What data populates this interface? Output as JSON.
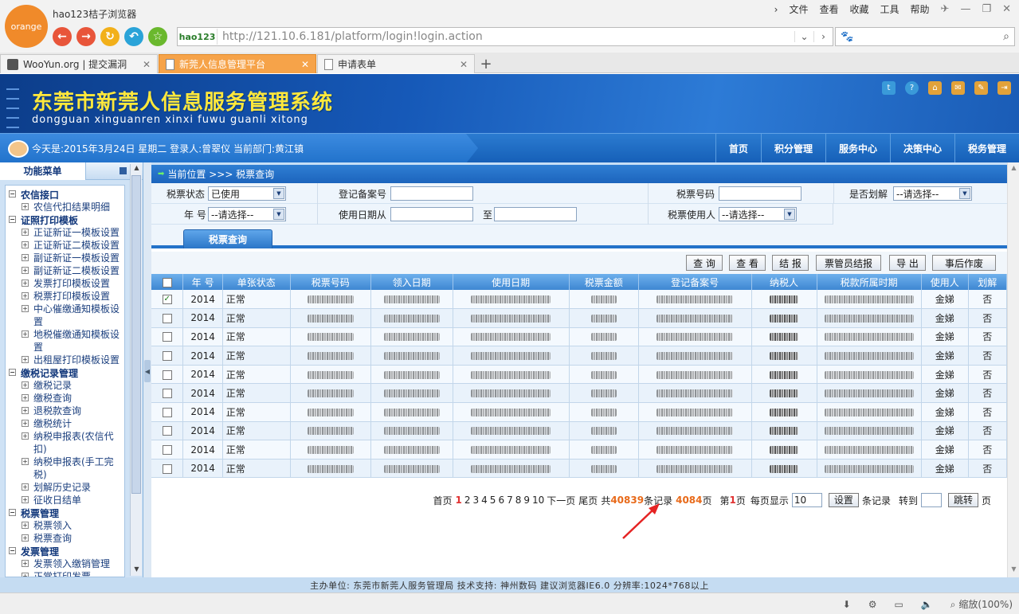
{
  "browser": {
    "logo_text": "orange",
    "title": "hao123桔子浏览器",
    "menu": [
      "文件",
      "查看",
      "收藏",
      "工具",
      "帮助"
    ],
    "url": "http://121.10.6.181/platform/login!login.action",
    "hao_badge": "hao123",
    "tabs": [
      {
        "label": "WooYun.org | 提交漏洞"
      },
      {
        "label": "新莞人信息管理平台"
      },
      {
        "label": "申请表单"
      }
    ],
    "status_zoom": "缩放(100%)"
  },
  "site": {
    "title": "东莞市新莞人信息服务管理系统",
    "subtitle": "dongguan xinguanren xinxi fuwu guanli xitong",
    "info": "今天是:2015年3月24日 星期二 登录人:曾翠仪 当前部门:黄江镇",
    "topnav": [
      "首页",
      "积分管理",
      "服务中心",
      "决策中心",
      "税务管理"
    ],
    "footer": "主办单位: 东莞市新莞人服务管理局    技术支持: 神州数码    建议浏览器IE6.0 分辨率:1024*768以上"
  },
  "sidebar": {
    "title": "功能菜单",
    "tree": [
      {
        "type": "group",
        "label": "农信接口"
      },
      {
        "type": "item",
        "label": "农信代扣结果明细"
      },
      {
        "type": "group",
        "label": "证照打印模板"
      },
      {
        "type": "item",
        "label": "正证新证一模板设置"
      },
      {
        "type": "item",
        "label": "正证新证二模板设置"
      },
      {
        "type": "item",
        "label": "副证新证一模板设置"
      },
      {
        "type": "item",
        "label": "副证新证二模板设置"
      },
      {
        "type": "item",
        "label": "发票打印模板设置"
      },
      {
        "type": "item",
        "label": "税票打印模板设置"
      },
      {
        "type": "item",
        "label": "中心催缴通知模板设置"
      },
      {
        "type": "item",
        "label": "地税催缴通知模板设置"
      },
      {
        "type": "item",
        "label": "出租屋打印模板设置"
      },
      {
        "type": "group",
        "label": "缴税记录管理"
      },
      {
        "type": "item",
        "label": "缴税记录"
      },
      {
        "type": "item",
        "label": "缴税查询"
      },
      {
        "type": "item",
        "label": "退税款查询"
      },
      {
        "type": "item",
        "label": "缴税统计"
      },
      {
        "type": "item",
        "label": "纳税申报表(农信代扣)"
      },
      {
        "type": "item",
        "label": "纳税申报表(手工完税)"
      },
      {
        "type": "item",
        "label": "划解历史记录"
      },
      {
        "type": "item",
        "label": "征收日结单"
      },
      {
        "type": "group",
        "label": "税票管理"
      },
      {
        "type": "item",
        "label": "税票领入"
      },
      {
        "type": "item",
        "label": "税票查询"
      },
      {
        "type": "group",
        "label": "发票管理"
      },
      {
        "type": "item",
        "label": "发票领入缴销管理"
      },
      {
        "type": "item",
        "label": "正常打印发票"
      }
    ]
  },
  "main": {
    "breadcrumb": "当前位置 >>> 税票查询",
    "filters": {
      "ticket_status_label": "税票状态",
      "ticket_status_value": "已使用",
      "reg_no_label": "登记备案号",
      "ticket_no_label": "税票号码",
      "split_label": "是否划解",
      "split_value": "--请选择--",
      "year_label": "年 号",
      "year_value": "--请选择--",
      "use_date_label": "使用日期从",
      "to_label": "至",
      "ticket_user_label": "税票使用人",
      "ticket_user_value": "--请选择--"
    },
    "query_tab": "税票查询",
    "toolbar": [
      "查 询",
      "查 看",
      "结 报",
      "票管员结报",
      "导 出",
      "事后作废"
    ],
    "columns": [
      "年 号",
      "单张状态",
      "税票号码",
      "领入日期",
      "使用日期",
      "税票金额",
      "登记备案号",
      "纳税人",
      "税款所属时期",
      "使用人",
      "划解"
    ],
    "rows": [
      {
        "checked": true,
        "year": "2014",
        "status": "正常",
        "user": "金娣",
        "split": "否"
      },
      {
        "checked": false,
        "year": "2014",
        "status": "正常",
        "user": "金娣",
        "split": "否"
      },
      {
        "checked": false,
        "year": "2014",
        "status": "正常",
        "user": "金娣",
        "split": "否"
      },
      {
        "checked": false,
        "year": "2014",
        "status": "正常",
        "user": "金娣",
        "split": "否"
      },
      {
        "checked": false,
        "year": "2014",
        "status": "正常",
        "user": "金娣",
        "split": "否"
      },
      {
        "checked": false,
        "year": "2014",
        "status": "正常",
        "user": "金娣",
        "split": "否"
      },
      {
        "checked": false,
        "year": "2014",
        "status": "正常",
        "user": "金娣",
        "split": "否"
      },
      {
        "checked": false,
        "year": "2014",
        "status": "正常",
        "user": "金娣",
        "split": "否"
      },
      {
        "checked": false,
        "year": "2014",
        "status": "正常",
        "user": "金娣",
        "split": "否"
      },
      {
        "checked": false,
        "year": "2014",
        "status": "正常",
        "user": "金娣",
        "split": "否"
      }
    ],
    "pager": {
      "first": "首页",
      "current_page": "1",
      "pages": [
        "2",
        "3",
        "4",
        "5",
        "6",
        "7",
        "8",
        "9",
        "10"
      ],
      "next": "下一页",
      "last": "尾页",
      "total_prefix": "共",
      "total_records": "40839",
      "records_suffix": "条记录",
      "total_pages": "4084",
      "pages_suffix": "页",
      "page_prefix": "第",
      "page_suffix": "页",
      "per_page_label": "每页显示",
      "per_page_value": "10",
      "set_button": "设置",
      "per_page_suffix": "条记录",
      "goto_label": "转到",
      "jump_button": "跳转",
      "goto_suffix": "页"
    }
  }
}
